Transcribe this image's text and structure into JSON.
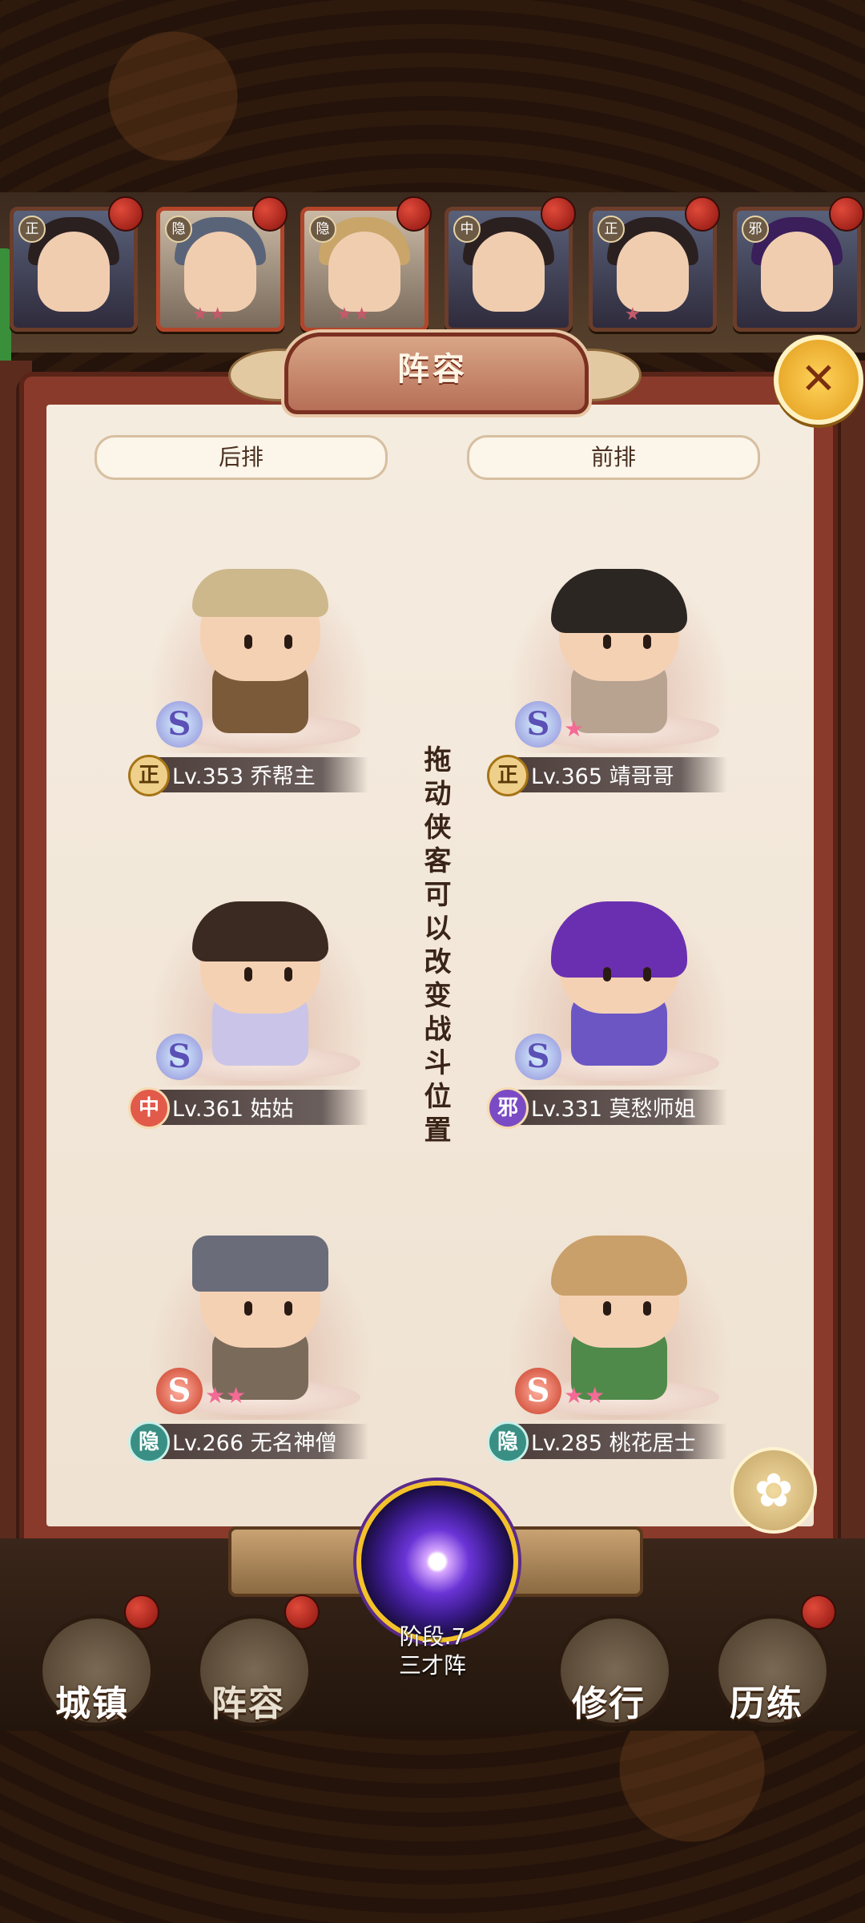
{
  "panel": {
    "title": "阵容",
    "close_icon": "✕"
  },
  "rows": {
    "back": "后排",
    "front": "前排"
  },
  "instruction": "拖动侠客可以改变战斗位置",
  "top_roster": [
    {
      "tag": "正",
      "stars": ""
    },
    {
      "tag": "隐",
      "stars": "★★"
    },
    {
      "tag": "隐",
      "stars": "★★"
    },
    {
      "tag": "中",
      "stars": ""
    },
    {
      "tag": "正",
      "stars": "★"
    },
    {
      "tag": "邪",
      "stars": ""
    }
  ],
  "heroes": [
    {
      "faction": "正",
      "name": "Lv.353 乔帮主",
      "stars": "",
      "badge": "S"
    },
    {
      "faction": "正",
      "name": "Lv.365 靖哥哥",
      "stars": "★",
      "badge": "S"
    },
    {
      "faction": "中",
      "name": "Lv.361 姑姑",
      "stars": "",
      "badge": "S"
    },
    {
      "faction": "邪",
      "name": "Lv.331 莫愁师姐",
      "stars": "",
      "badge": "S"
    },
    {
      "faction": "隐",
      "name": "Lv.266 无名神僧",
      "stars": "★★",
      "badge": "S"
    },
    {
      "faction": "隐",
      "name": "Lv.285 桃花居士",
      "stars": "★★",
      "badge": "S"
    }
  ],
  "formation": {
    "stage": "阶段.7",
    "name": "三才阵"
  },
  "nav": [
    {
      "label": "城镇"
    },
    {
      "label": "阵容"
    },
    {
      "label": "修行"
    },
    {
      "label": "历练"
    }
  ],
  "colors": {
    "accent": "#f3c22a",
    "panel_red": "#8a3a2a",
    "paper": "#f5ece0"
  }
}
